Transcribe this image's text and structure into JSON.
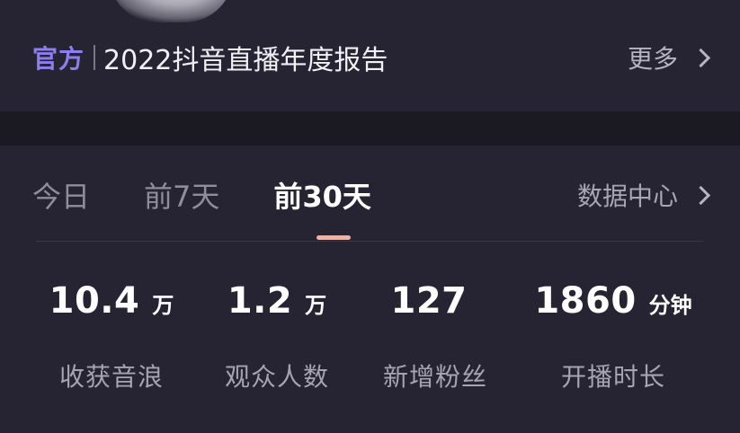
{
  "report": {
    "badge": "官方",
    "title": "2022抖音直播年度报告",
    "more_label": "更多"
  },
  "tabs": [
    {
      "label": "今日"
    },
    {
      "label": "前7天"
    },
    {
      "label": "前30天",
      "active": true
    }
  ],
  "data_center_label": "数据中心",
  "metrics": [
    {
      "value": "10.4",
      "unit": "万",
      "label": "收获音浪"
    },
    {
      "value": "1.2",
      "unit": "万",
      "label": "观众人数"
    },
    {
      "value": "127",
      "unit": "",
      "label": "新增粉丝"
    },
    {
      "value": "1860",
      "unit": "分钟",
      "label": "开播时长"
    }
  ],
  "colors": {
    "accent_badge": "#8d7ef0",
    "tab_underline": "#e8b5a8",
    "card_bg": "#262432"
  }
}
